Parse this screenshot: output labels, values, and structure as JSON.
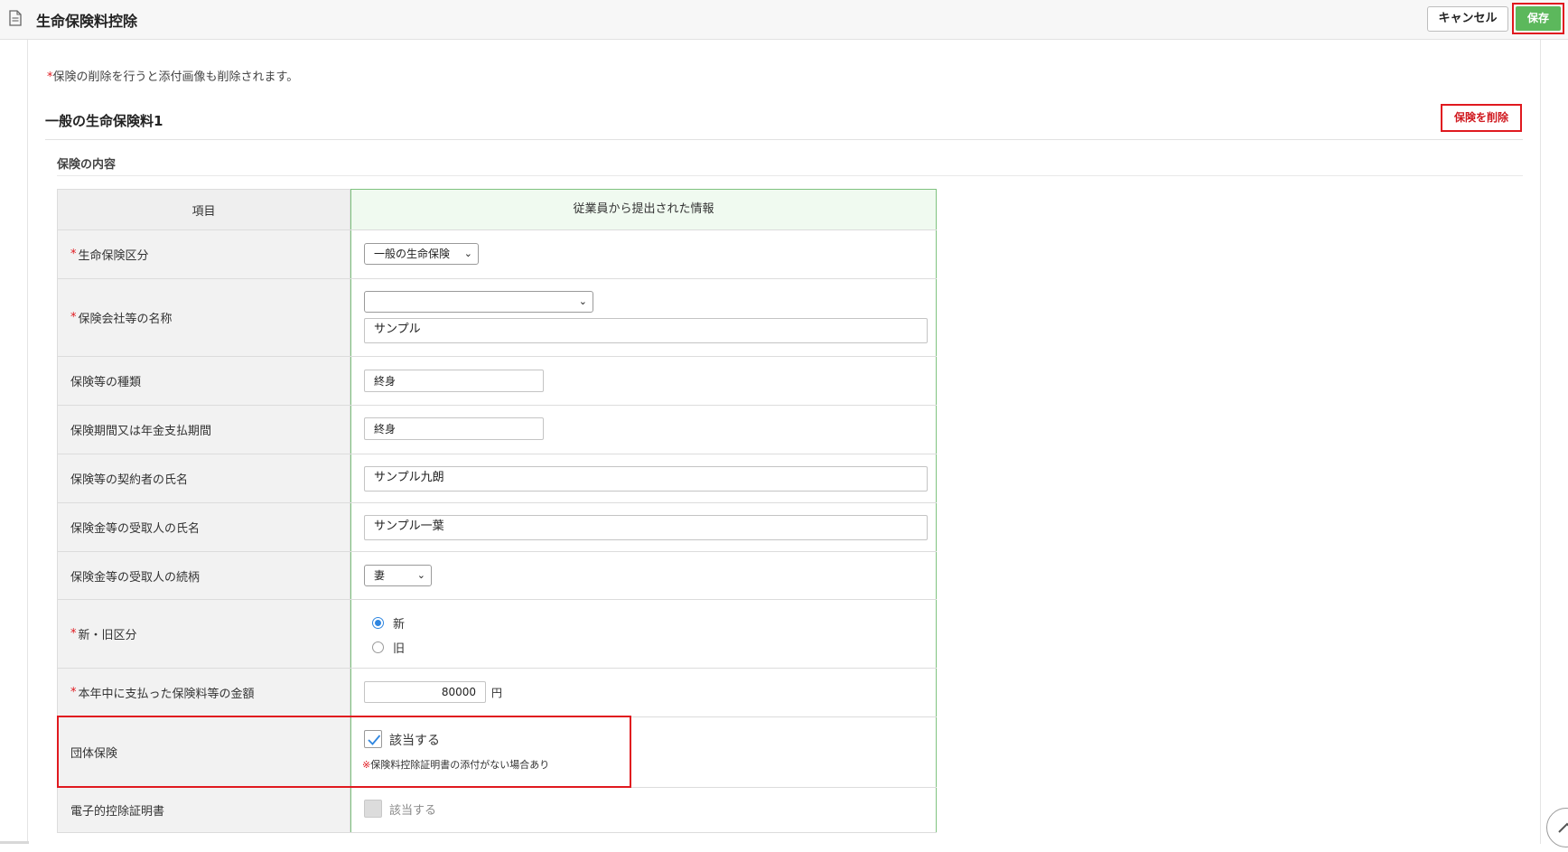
{
  "header": {
    "title": "生命保険料控除",
    "cancel_label": "キャンセル",
    "save_label": "保存"
  },
  "notice": {
    "mark": "*",
    "text": "保険の削除を行うと添付画像も削除されます。"
  },
  "section": {
    "title": "一般の生命保険料1",
    "delete_label": "保険を削除",
    "subsection_title": "保険の内容"
  },
  "table": {
    "col_item": "項目",
    "col_info": "従業員から提出された情報",
    "rows": [
      {
        "label": "生命保険区分",
        "required": true,
        "value": "一般の生命保険"
      },
      {
        "label": "保険会社等の名称",
        "required": true,
        "select_value": "",
        "value": "サンプル"
      },
      {
        "label": "保険等の種類",
        "required": false,
        "value": "終身"
      },
      {
        "label": "保険期間又は年金支払期間",
        "required": false,
        "value": "終身"
      },
      {
        "label": "保険等の契約者の氏名",
        "required": false,
        "value": "サンプル九朗"
      },
      {
        "label": "保険金等の受取人の氏名",
        "required": false,
        "value": "サンプル一葉"
      },
      {
        "label": "保険金等の受取人の続柄",
        "required": false,
        "value": "妻"
      },
      {
        "label": "新・旧区分",
        "required": true,
        "options": [
          "新",
          "旧"
        ],
        "selected": "新"
      },
      {
        "label": "本年中に支払った保険料等の金額",
        "required": true,
        "value": "80000",
        "unit": "円"
      },
      {
        "label": "団体保険",
        "required": false,
        "checkbox_label": "該当する",
        "checked": true,
        "note_mark": "※",
        "note": "保険料控除証明書の添付がない場合あり"
      },
      {
        "label": "電子的控除証明書",
        "required": false,
        "checkbox_label": "該当する",
        "checked": false,
        "disabled": true
      }
    ]
  },
  "colors": {
    "accent_green": "#5cb85c",
    "highlight_red": "#e0191f",
    "radio_blue": "#2f86e0",
    "table_green_border": "#7fc27f"
  }
}
